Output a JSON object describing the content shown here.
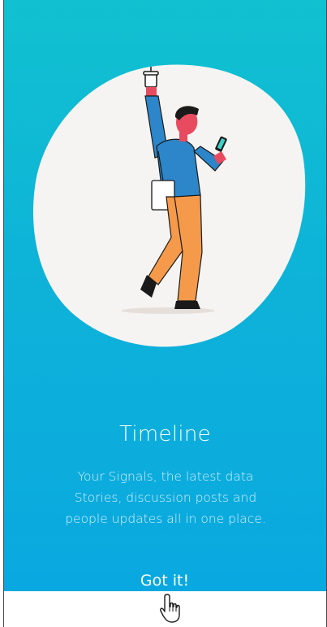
{
  "onboarding": {
    "title": "Timeline",
    "description": "Your Signals, the latest data Stories, discussion posts and people updates all in one place.",
    "cta_label": "Got it!"
  },
  "colors": {
    "gradient_top": "#11c1d0",
    "gradient_bottom": "#0aa8e0",
    "blob": "#f6f4f2",
    "text": "#ffffff"
  },
  "icons": {
    "illustration": "walking-man-with-phone-illustration",
    "cursor": "hand-pointer-icon"
  }
}
